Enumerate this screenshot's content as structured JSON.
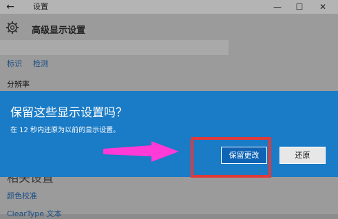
{
  "window": {
    "title": "设置",
    "controls": {
      "minimize": "—",
      "maximize": "☐",
      "close": "✕"
    }
  },
  "header": {
    "page_title": "高级显示设置"
  },
  "display": {
    "links": [
      "标识",
      "检测"
    ],
    "resolution_label": "分辨率"
  },
  "dialog": {
    "title": "保留这些显示设置吗？",
    "message": "在 12 秒内还原为以前的显示设置。",
    "countdown_seconds": 12,
    "buttons": {
      "keep": "保留更改",
      "revert": "还原"
    }
  },
  "related": {
    "section_heading": "相关设置",
    "links": [
      "颜色校准",
      "ClearType 文本"
    ]
  },
  "annotations": {
    "highlight_color": "#e03a3a",
    "arrow_color": "#ff3ad6"
  }
}
